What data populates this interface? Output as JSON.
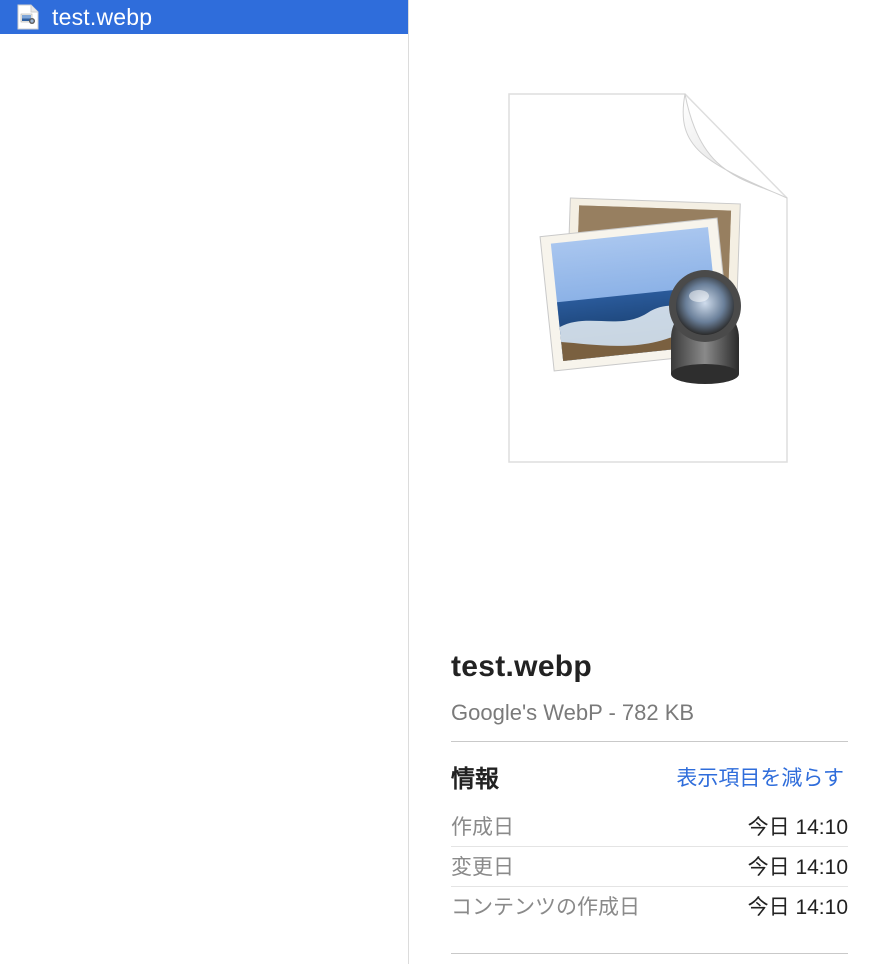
{
  "sidebar": {
    "selected_file": "test.webp"
  },
  "preview": {
    "title": "test.webp",
    "subtitle": "Google's WebP - 782 KB",
    "info": {
      "heading": "情報",
      "toggle_link": "表示項目を減らす",
      "rows": [
        {
          "label": "作成日",
          "value": "今日 14:10"
        },
        {
          "label": "変更日",
          "value": "今日 14:10"
        },
        {
          "label": "コンテンツの作成日",
          "value": "今日 14:10"
        }
      ]
    }
  },
  "colors": {
    "selection": "#2f6ddb",
    "link": "#2f6ddb"
  },
  "icons": [
    "image-file-icon",
    "preview-document-icon"
  ]
}
